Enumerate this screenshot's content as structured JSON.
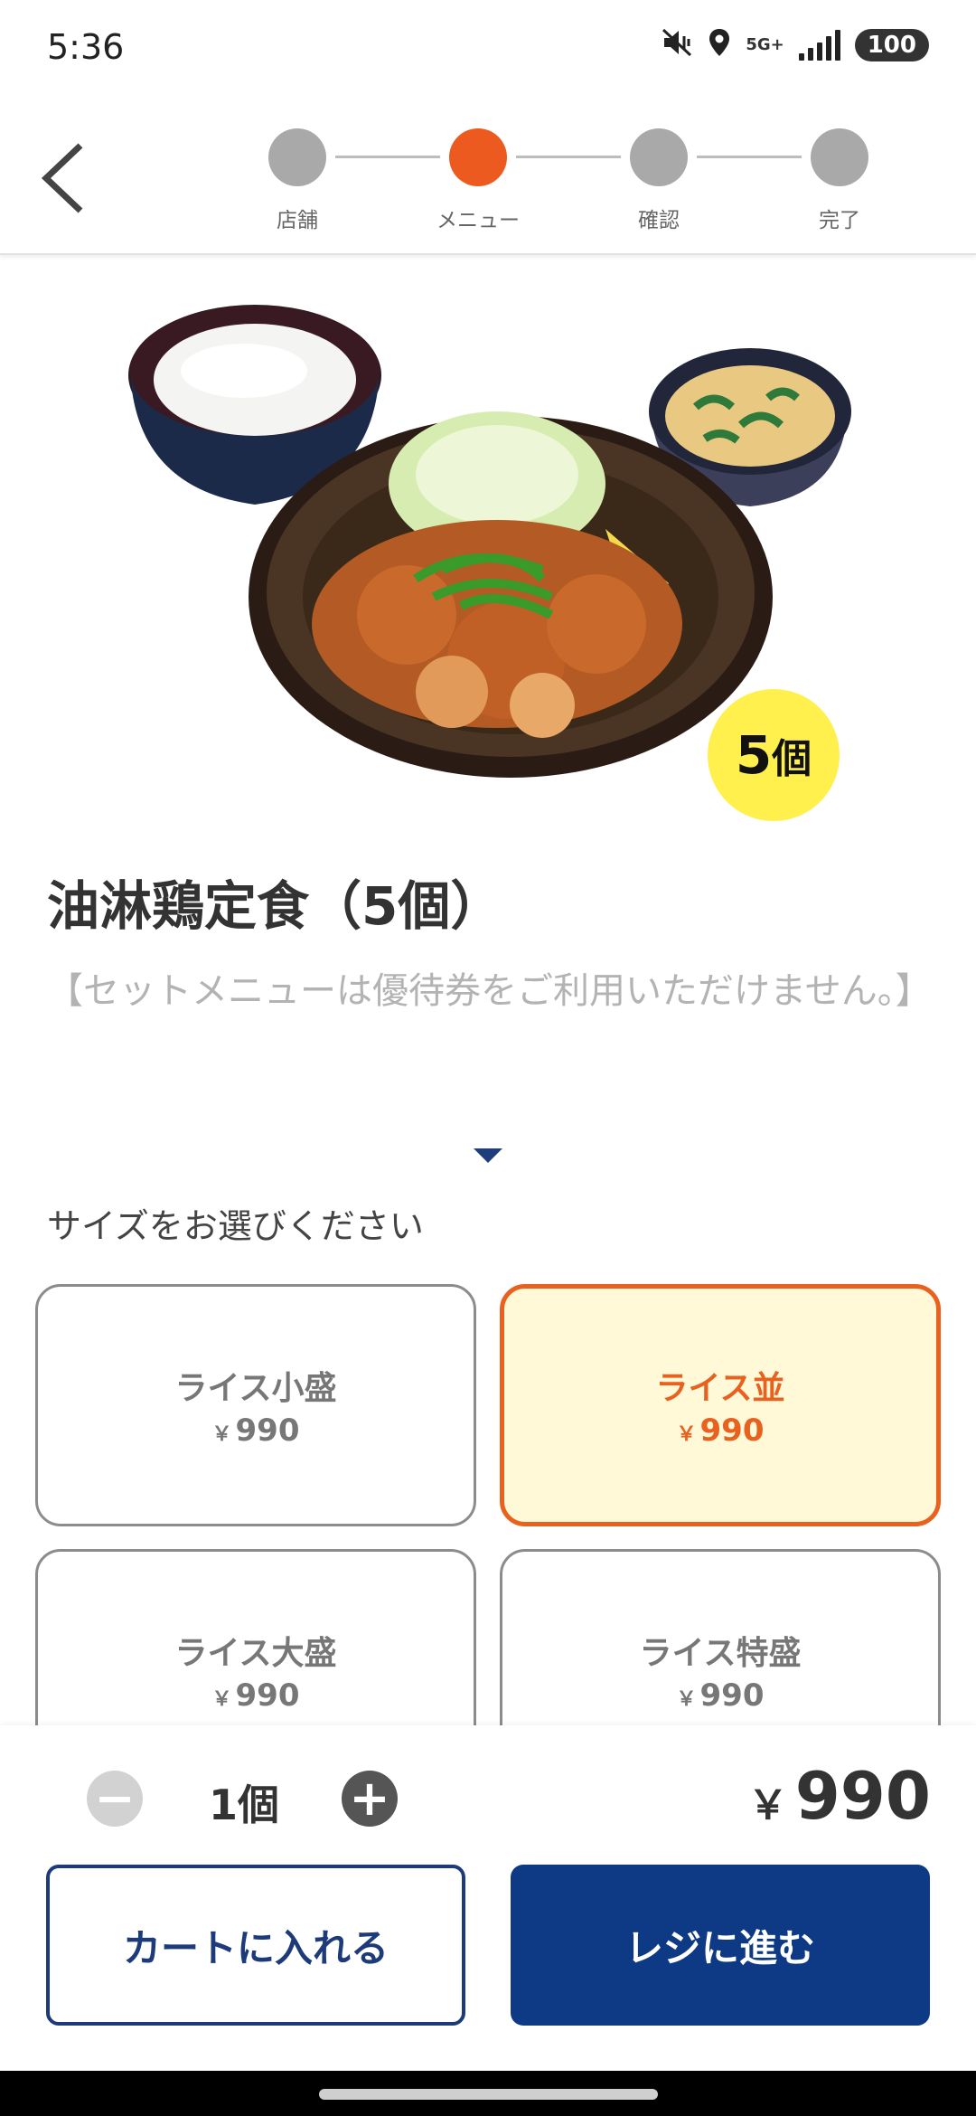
{
  "status_bar": {
    "time": "5:36",
    "network_label": "5G+",
    "battery": "100",
    "icons": [
      "mute-vibrate-icon",
      "location-icon",
      "signal-icon"
    ]
  },
  "header": {
    "back_icon": "chevron-left-icon",
    "steps": [
      {
        "label": "店舗",
        "active": false
      },
      {
        "label": "メニュー",
        "active": true
      },
      {
        "label": "確認",
        "active": false
      },
      {
        "label": "完了",
        "active": false
      }
    ]
  },
  "product": {
    "badge_number": "5",
    "badge_unit": "個",
    "title": "油淋鶏定食（5個）",
    "note": "【セットメニューは優待券をご利用いただけません。】"
  },
  "size_selection": {
    "prompt": "サイズをお選びください",
    "options": [
      {
        "name": "ライス小盛",
        "yen": "￥",
        "price": "990",
        "selected": false
      },
      {
        "name": "ライス並",
        "yen": "￥",
        "price": "990",
        "selected": true
      },
      {
        "name": "ライス大盛",
        "yen": "￥",
        "price": "990",
        "selected": false
      },
      {
        "name": "ライス特盛",
        "yen": "￥",
        "price": "990",
        "selected": false
      }
    ]
  },
  "order": {
    "quantity": "1個",
    "minus_label": "−",
    "plus_label": "+",
    "total_yen": "￥",
    "total_amount": "990",
    "cart_button": "カートに入れる",
    "checkout_button": "レジに進む"
  },
  "colors": {
    "accent_orange": "#ec5a1f",
    "navy": "#0e3a85",
    "selected_bg": "#fff9d8",
    "badge_yellow": "#fff04d"
  }
}
